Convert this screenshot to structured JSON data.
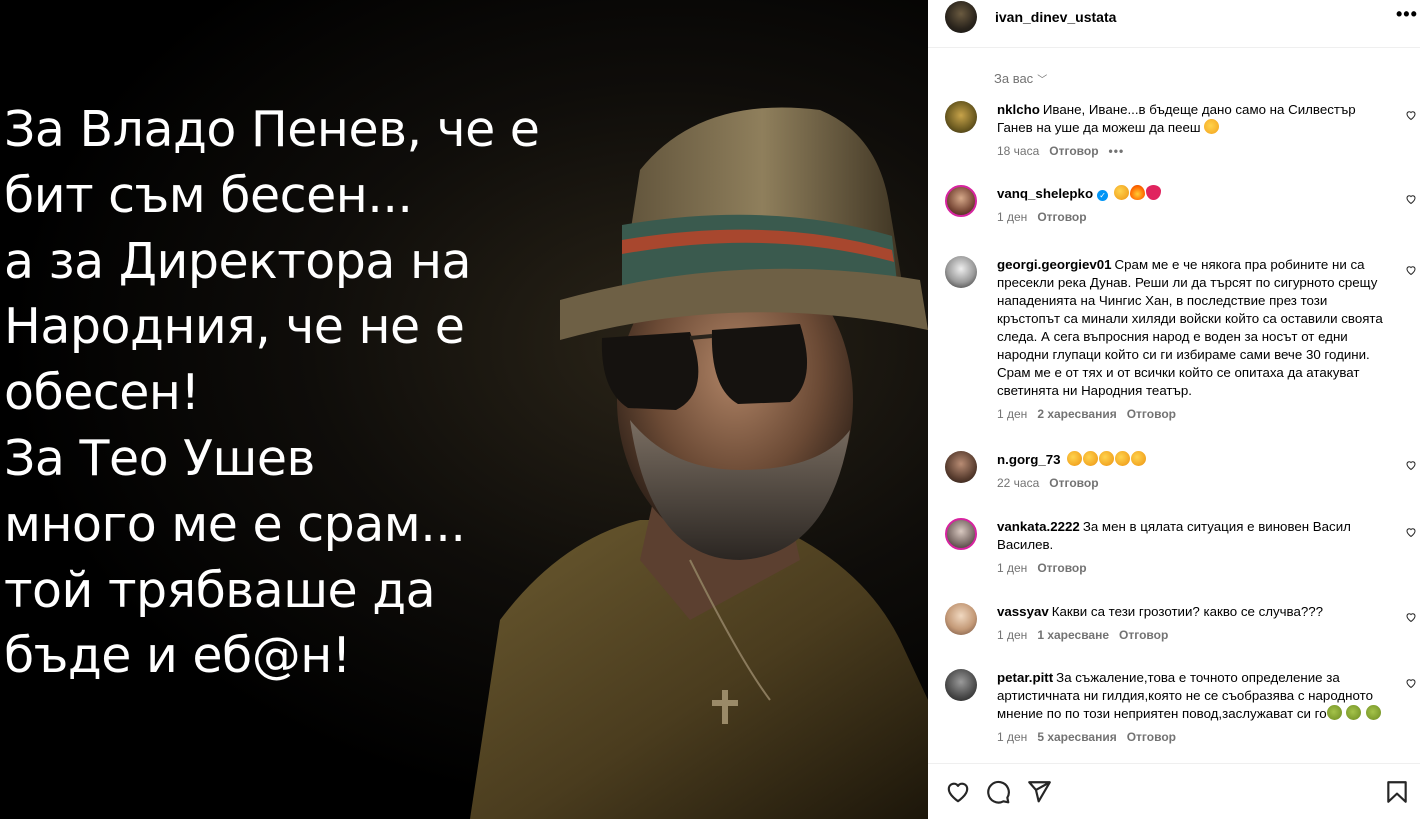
{
  "post": {
    "text_lines": [
      "За Владо Пенев, че е",
      "бит съм бесен...",
      "а за Директора на",
      "Народния, че не е",
      "обесен!",
      "За Тео Ушев",
      "много ме е срам...",
      "той трябваше да",
      "бъде и еб@н!"
    ]
  },
  "header": {
    "username": "ivan_dinev_ustata",
    "more_icon": "more-horizontal-icon"
  },
  "filter": {
    "label": "За вас"
  },
  "comments": [
    {
      "user": "nklcho",
      "text": "Иване, Иване...в бъдеще дано само на Силвестър Ганев на уше да можеш да пееш",
      "emojis": [
        "wink"
      ],
      "time": "18 часа",
      "likes": "",
      "reply": "Отговор",
      "more": "•••"
    },
    {
      "user": "vanq_shelepko",
      "verified": true,
      "text": "",
      "emojis": [
        "clap",
        "fire",
        "heart"
      ],
      "time": "1 ден",
      "likes": "",
      "reply": "Отговор"
    },
    {
      "user": "georgi.georgiev01",
      "text": "Срам ме е че някога пра робините ни са пресекли река Дунав. Реши ли да търсят по сигурното срещу нападенията на Чингис Хан, в последствие през този кръстопът са минали хиляди войски който са оставили своята следа. А сега въпросния народ е воден за носът от едни народни глупаци който си ги избираме сами вече 30 години. Срам ме е от тях и от всички който се опитаха да атакуват светинята ни Народния театър.",
      "emojis": [],
      "time": "1 ден",
      "likes": "2 харесвания",
      "reply": "Отговор"
    },
    {
      "user": "n.gorg_73",
      "text": "",
      "emojis": [
        "clap",
        "clap",
        "clap",
        "clap",
        "clap"
      ],
      "time": "22 часа",
      "likes": "",
      "reply": "Отговор"
    },
    {
      "user": "vankata.2222",
      "text": "За мен в цялата ситуация е виновен Васил Василев.",
      "emojis": [],
      "time": "1 ден",
      "likes": "",
      "reply": "Отговор"
    },
    {
      "user": "vassyav",
      "text": "Какви са тези грозотии? какво се случва???",
      "emojis": [],
      "time": "1 ден",
      "likes": "1 харесване",
      "reply": "Отговор"
    },
    {
      "user": "petar.pitt",
      "text": "За съжаление,това е точното определение за артистичната ни гилдия,която не се съобразява с народното мнение по по този неприятен повод,заслужават си го",
      "emojis": [
        "sick",
        "sick",
        "sick"
      ],
      "time": "1 ден",
      "likes": "5 харесвания",
      "reply": "Отговор"
    }
  ],
  "actions": [
    "heart-icon",
    "comment-icon",
    "share-icon",
    "bookmark-icon"
  ],
  "colors": {
    "meta_gray": "#737373",
    "verified_blue": "#0095f6",
    "story_ring": "#d6249f"
  }
}
